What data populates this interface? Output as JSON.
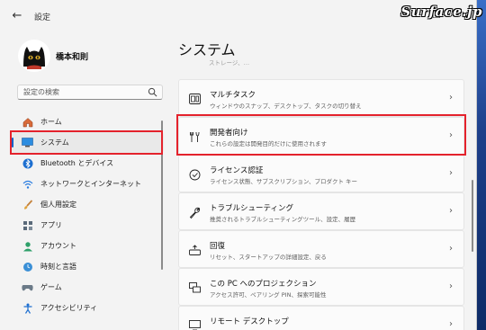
{
  "watermark": "Surface.jp",
  "titlebar": {
    "back": "←",
    "title": "設定",
    "min": "—",
    "max": "☐",
    "close": "✕"
  },
  "profile": {
    "name": "橋本和則"
  },
  "search": {
    "placeholder": "設定の検索"
  },
  "nav": [
    {
      "label": "ホーム",
      "icon": "home-icon"
    },
    {
      "label": "システム",
      "icon": "monitor-icon",
      "selected": true
    },
    {
      "label": "Bluetooth とデバイス",
      "icon": "bluetooth-icon"
    },
    {
      "label": "ネットワークとインターネット",
      "icon": "wifi-icon"
    },
    {
      "label": "個人用設定",
      "icon": "brush-icon"
    },
    {
      "label": "アプリ",
      "icon": "apps-icon"
    },
    {
      "label": "アカウント",
      "icon": "account-icon"
    },
    {
      "label": "時刻と言語",
      "icon": "clock-globe-icon"
    },
    {
      "label": "ゲーム",
      "icon": "gamepad-icon"
    },
    {
      "label": "アクセシビリティ",
      "icon": "accessibility-icon"
    }
  ],
  "main": {
    "title": "システム",
    "faded_text": "ストレージ、…",
    "cards": [
      {
        "title": "マルチタスク",
        "desc": "ウィンドウのスナップ、デスクトップ、タスクの切り替え",
        "icon": "multitask-icon"
      },
      {
        "title": "開発者向け",
        "desc": "これらの設定は開発目的だけに使用されます",
        "icon": "developer-tools-icon"
      },
      {
        "title": "ライセンス認証",
        "desc": "ライセンス状態、サブスクリプション、プロダクト キー",
        "icon": "activation-icon"
      },
      {
        "title": "トラブルシューティング",
        "desc": "推奨されるトラブルシューティングツール、設定、履歴",
        "icon": "wrench-icon"
      },
      {
        "title": "回復",
        "desc": "リセット、スタートアップの詳細設定、戻る",
        "icon": "recovery-icon"
      },
      {
        "title": "この PC へのプロジェクション",
        "desc": "アクセス許可、ペアリング PIN、探索可能性",
        "icon": "projection-icon"
      },
      {
        "title": "リモート デスクトップ",
        "desc": "",
        "icon": "remote-desktop-icon"
      }
    ],
    "chevron": "›"
  },
  "colors": {
    "accent": "#0a5fc7",
    "highlight": "#e4222c",
    "background": "#f3f3f3",
    "card": "#fbfbfb"
  }
}
